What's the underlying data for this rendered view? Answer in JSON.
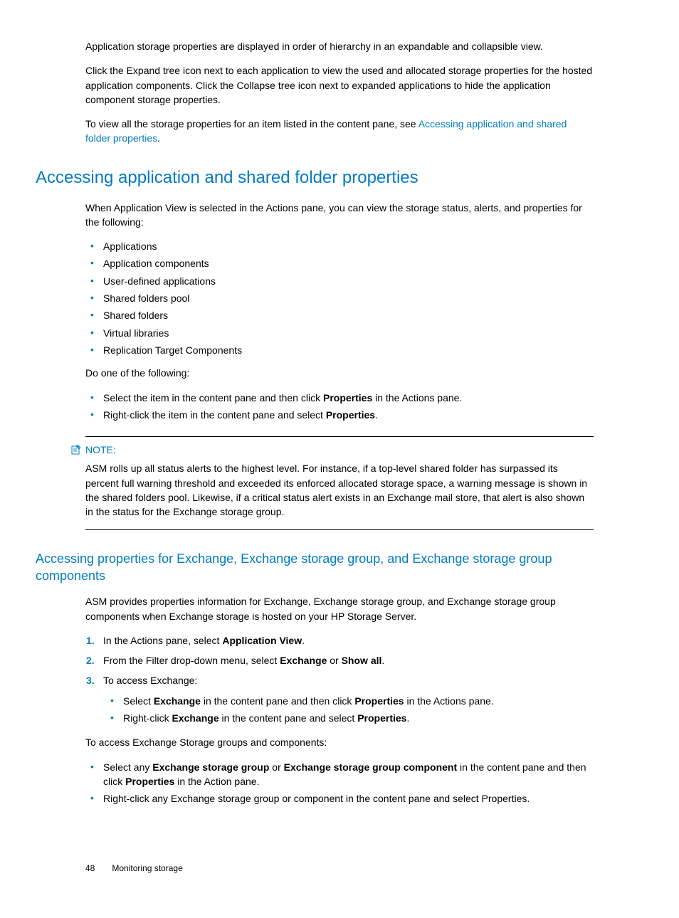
{
  "intro": {
    "p1": "Application storage properties are displayed in order of hierarchy in an expandable and collapsible view.",
    "p2": "Click the Expand tree icon next to each application to view the used and allocated storage properties for the hosted application components. Click the Collapse tree icon next to expanded applications to hide the application component storage properties.",
    "p3a": "To view all the storage properties for an item listed in the content pane, see ",
    "p3link": "Accessing application and shared folder properties",
    "p3b": "."
  },
  "h1": "Accessing application and shared folder properties",
  "s1": {
    "p1": "When Application View is selected in the Actions pane, you can view the storage status, alerts, and properties for the following:",
    "list1": [
      "Applications",
      "Application components",
      "User-defined applications",
      "Shared folders pool",
      "Shared folders",
      "Virtual libraries",
      "Replication Target Components"
    ],
    "p2": "Do one of the following:",
    "list2": {
      "i0a": "Select the item in the content pane and then click ",
      "i0b": "Properties",
      "i0c": " in the Actions pane.",
      "i1a": "Right-click the item in the content pane and select ",
      "i1b": "Properties",
      "i1c": "."
    }
  },
  "note": {
    "label": "NOTE:",
    "text": "ASM rolls up all status alerts to the highest level. For instance, if a top-level shared folder has surpassed its percent full warning threshold and exceeded its enforced allocated storage space, a warning message is shown in the shared folders pool. Likewise, if a critical status alert exists in an Exchange mail store, that alert is also shown in the status for the Exchange storage group."
  },
  "h2": "Accessing properties for Exchange, Exchange storage group, and Exchange storage group components",
  "s2": {
    "p1": "ASM provides properties information for Exchange, Exchange storage group, and Exchange storage group components when Exchange storage is hosted on your HP Storage Server.",
    "ol": {
      "i1a": "In the Actions pane, select ",
      "i1b": "Application View",
      "i1c": ".",
      "i2a": "From the Filter drop-down menu, select ",
      "i2b": "Exchange",
      "i2c": " or ",
      "i2d": "Show all",
      "i2e": ".",
      "i3": "To access Exchange:",
      "i3s1a": "Select ",
      "i3s1b": "Exchange",
      "i3s1c": " in the content pane and then click ",
      "i3s1d": "Properties",
      "i3s1e": " in the Actions pane.",
      "i3s2a": "Right-click ",
      "i3s2b": "Exchange",
      "i3s2c": " in the content pane and select ",
      "i3s2d": "Properties",
      "i3s2e": "."
    },
    "p2": "To access Exchange Storage groups and components:",
    "list3": {
      "i0a": "Select any ",
      "i0b": "Exchange storage group",
      "i0c": " or ",
      "i0d": "Exchange storage group component",
      "i0e": " in the content pane and then click ",
      "i0f": "Properties",
      "i0g": " in the Action pane.",
      "i1": "Right-click any Exchange storage group or component in the content pane and select Properties."
    }
  },
  "footer": {
    "page": "48",
    "section": "Monitoring storage"
  }
}
